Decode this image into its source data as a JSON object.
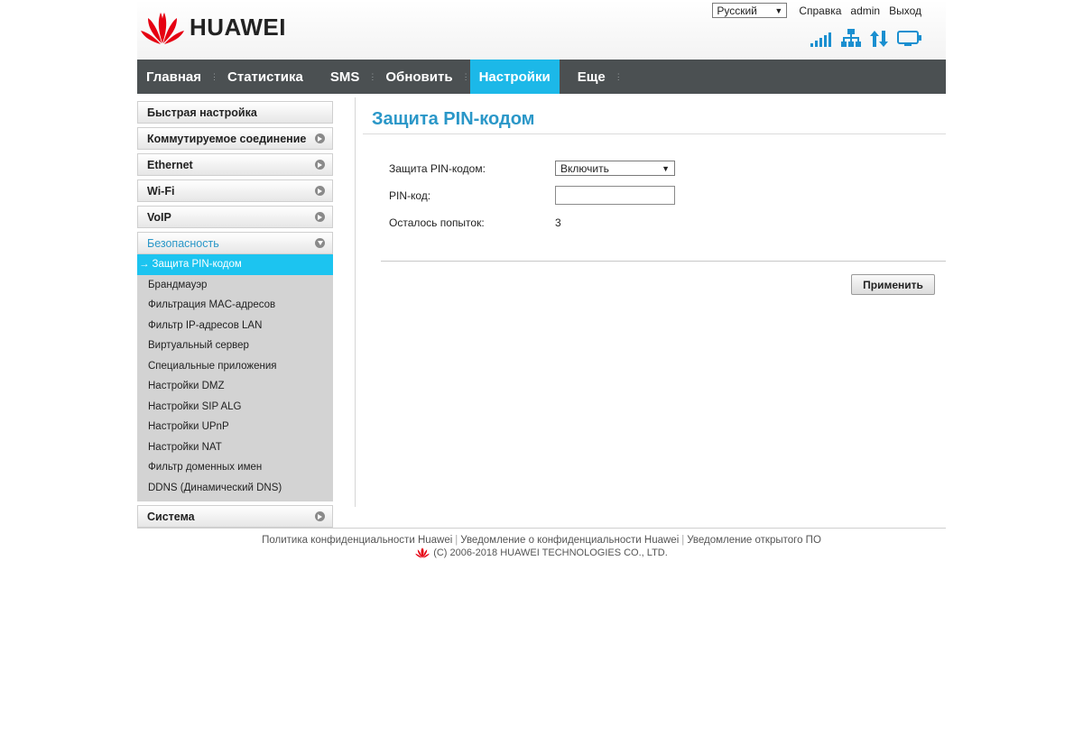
{
  "header": {
    "brand": "HUAWEI",
    "language": "Русский",
    "links": {
      "help": "Справка",
      "user": "admin",
      "logout": "Выход"
    }
  },
  "nav": {
    "items": [
      {
        "label": "Главная"
      },
      {
        "label": "Статистика"
      },
      {
        "label": "SMS"
      },
      {
        "label": "Обновить"
      },
      {
        "label": "Настройки"
      },
      {
        "label": "Еще"
      }
    ]
  },
  "sidebar": {
    "items": [
      {
        "label": "Быстрая настройка"
      },
      {
        "label": "Коммутируемое соединение"
      },
      {
        "label": "Ethernet"
      },
      {
        "label": "Wi-Fi"
      },
      {
        "label": "VoIP"
      },
      {
        "label": "Безопасность"
      },
      {
        "label": "Система"
      }
    ],
    "security_sub": [
      {
        "label": "Защита PIN-кодом"
      },
      {
        "label": "Брандмауэр"
      },
      {
        "label": "Фильтрация MAC-адресов"
      },
      {
        "label": "Фильтр IP-адресов LAN"
      },
      {
        "label": "Виртуальный сервер"
      },
      {
        "label": "Специальные приложения"
      },
      {
        "label": "Настройки DMZ"
      },
      {
        "label": "Настройки SIP ALG"
      },
      {
        "label": "Настройки UPnP"
      },
      {
        "label": "Настройки NAT"
      },
      {
        "label": "Фильтр доменных имен"
      },
      {
        "label": "DDNS (Динамический DNS)"
      }
    ]
  },
  "content": {
    "title": "Защита PIN-кодом",
    "pin_protection_label": "Защита PIN-кодом:",
    "pin_protection_value": "Включить",
    "pin_code_label": "PIN-код:",
    "pin_code_value": "",
    "attempts_label": "Осталось попыток:",
    "attempts_value": "3",
    "apply_button": "Применить"
  },
  "footer": {
    "links": [
      "Политика конфиденциальности Huawei",
      "Уведомление о конфиденциальности Huawei",
      "Уведомление открытого ПО"
    ],
    "copyright": "(C) 2006-2018 HUAWEI TECHNOLOGIES CO., LTD."
  },
  "colors": {
    "accent": "#1cb8e8",
    "nav_bg": "#4b5052",
    "title": "#2a97c8",
    "brand_red": "#e60012"
  },
  "icons": [
    "signal-icon",
    "network-icon",
    "data-transfer-icon",
    "monitor-icon"
  ]
}
